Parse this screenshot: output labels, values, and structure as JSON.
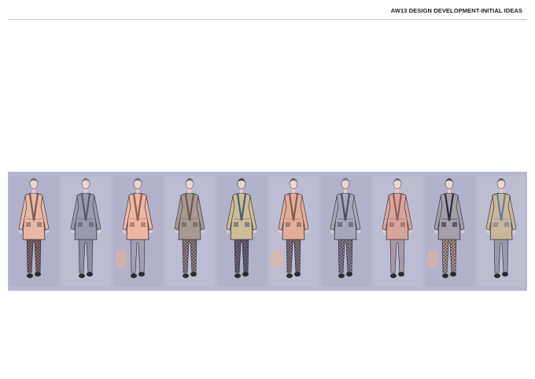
{
  "header": {
    "title": "AW13 DESIGN DEVELOPMENT-INITIAL IDEAS"
  },
  "lineup": {
    "looks": [
      {
        "jacket": "#e9b7a4",
        "top_pattern": "#7b5c55",
        "trousers": "#8a6f6a",
        "trouser_pattern": "check",
        "head": "#6b6b6b"
      },
      {
        "jacket": "#9a9aae",
        "top_pattern": "#5a5a6a",
        "trousers": "#8f8f9c",
        "trouser_pattern": "plain",
        "head": "#7a7a7a"
      },
      {
        "jacket": "#efb6a1",
        "top_pattern": "#8e5d52",
        "trousers": "#a5a0ad",
        "trouser_pattern": "plain",
        "head": "#6b6b6b"
      },
      {
        "jacket": "#a79a92",
        "top_pattern": "#6a5a52",
        "trousers": "#9a8d84",
        "trouser_pattern": "check",
        "head": "#5a5a5a"
      },
      {
        "jacket": "#cbbd94",
        "top_pattern": "#4d5a78",
        "trousers": "#6c6a7c",
        "trouser_pattern": "check",
        "head": "#222222"
      },
      {
        "jacket": "#e5ad98",
        "top_pattern": "#7b5b52",
        "trousers": "#8c7d80",
        "trouser_pattern": "check",
        "head": "#5a5a5a"
      },
      {
        "jacket": "#a6a7b7",
        "top_pattern": "#4e4f5e",
        "trousers": "#908a95",
        "trouser_pattern": "check",
        "head": "#7a7a7a"
      },
      {
        "jacket": "#d9a59a",
        "top_pattern": "#8d5d59",
        "trousers": "#a89aa5",
        "trouser_pattern": "plain",
        "head": "#6b6b6b"
      },
      {
        "jacket": "#a49fa8",
        "top_pattern": "#2d2d35",
        "trousers": "#b7a292",
        "trouser_pattern": "check",
        "head": "#3a3a3a"
      },
      {
        "jacket": "#c7b89a",
        "top_pattern": "#6a7aa0",
        "trousers": "#9a9aa6",
        "trouser_pattern": "plain",
        "head": "#5a5a5a"
      }
    ]
  }
}
